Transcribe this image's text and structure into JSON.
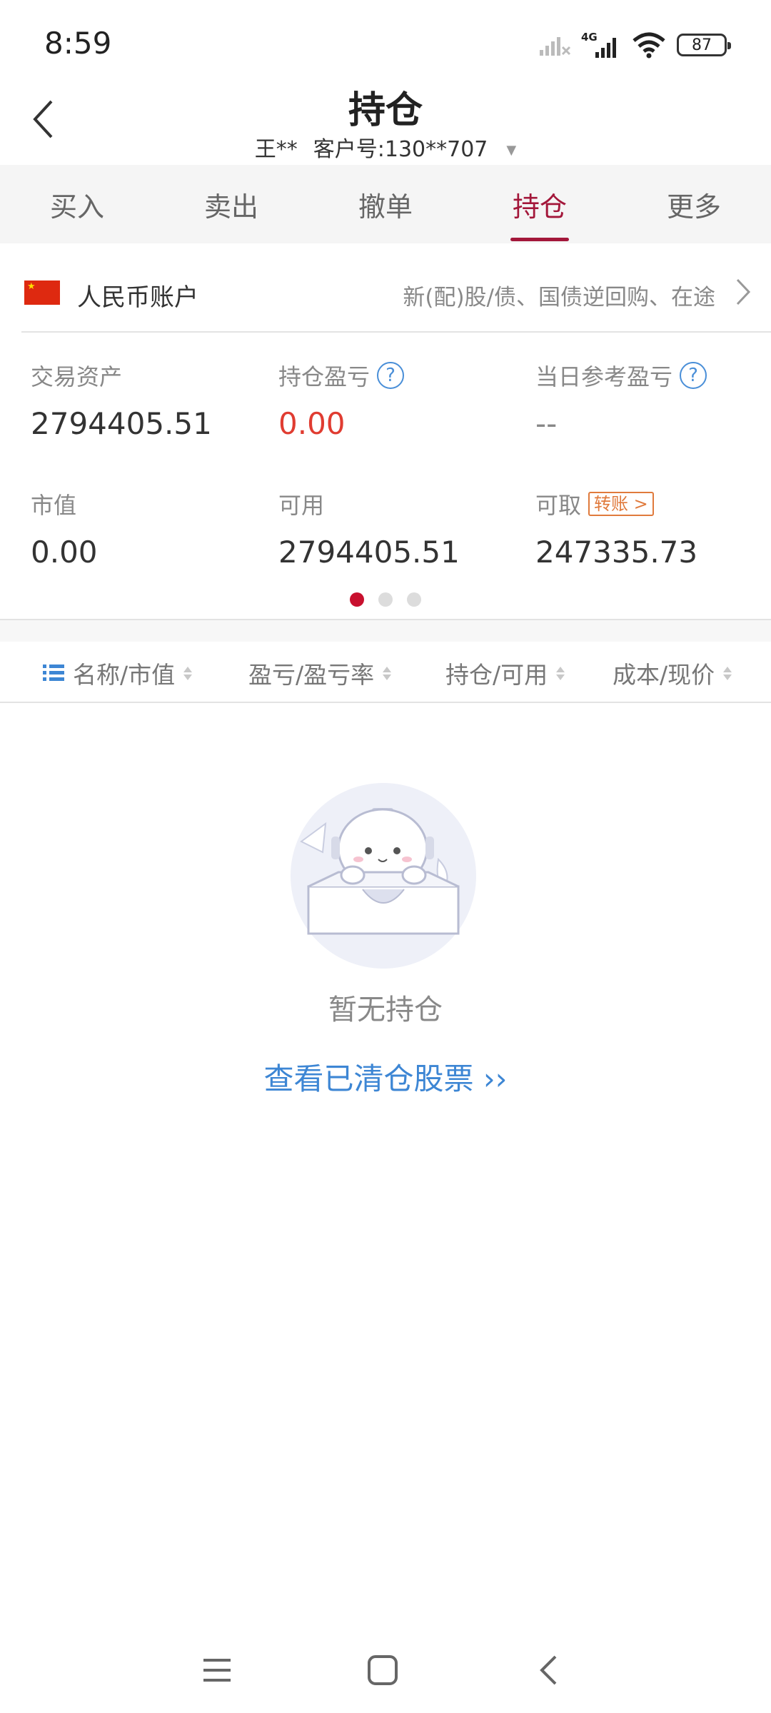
{
  "status_bar": {
    "time": "8:59",
    "network": "4G",
    "battery": "87"
  },
  "header": {
    "title": "持仓",
    "account_name": "王**",
    "customer_no": "客户号:130**707"
  },
  "tabs": [
    {
      "label": "买入",
      "active": false
    },
    {
      "label": "卖出",
      "active": false
    },
    {
      "label": "撤单",
      "active": false
    },
    {
      "label": "持仓",
      "active": true
    },
    {
      "label": "更多",
      "active": false
    }
  ],
  "account": {
    "name": "人民币账户",
    "extra": "新(配)股/债、国债逆回购、在途"
  },
  "assets": {
    "trade_assets_label": "交易资产",
    "trade_assets_value": "2794405.51",
    "position_pl_label": "持仓盈亏",
    "position_pl_value": "0.00",
    "daily_pl_label": "当日参考盈亏",
    "daily_pl_value": "--",
    "market_value_label": "市值",
    "market_value_value": "0.00",
    "available_label": "可用",
    "available_value": "2794405.51",
    "withdrawable_label": "可取",
    "withdrawable_value": "247335.73",
    "transfer_label": "转账 >"
  },
  "columns": {
    "name": "名称/市值",
    "pl": "盈亏/盈亏率",
    "position": "持仓/可用",
    "cost": "成本/现价"
  },
  "empty": {
    "text": "暂无持仓",
    "link": "查看已清仓股票 ››"
  },
  "colors": {
    "accent": "#a3173a",
    "loss_red": "#e03c31",
    "link_blue": "#3d86d4",
    "transfer_orange": "#e07a3c"
  }
}
